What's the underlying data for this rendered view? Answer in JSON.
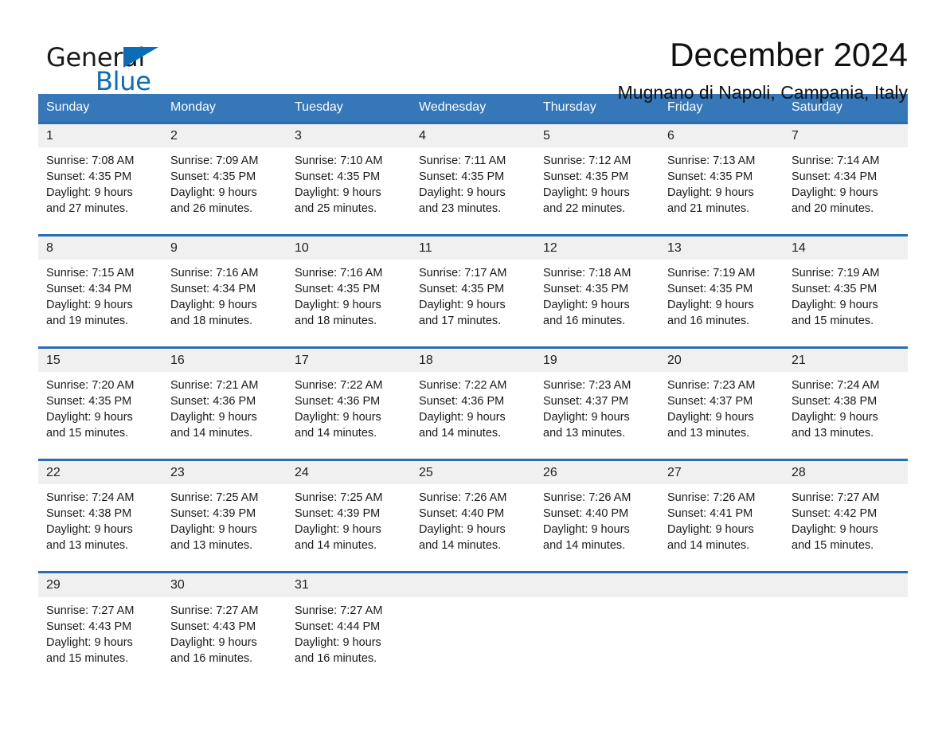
{
  "brand": {
    "name_part1": "General",
    "name_part2": "Blue",
    "accent_color": "#0b6cb7"
  },
  "header": {
    "month_title": "December 2024",
    "location": "Mugnano di Napoli, Campania, Italy"
  },
  "calendar": {
    "header_bg": "#3577b9",
    "row_divider_color": "#2b6cad",
    "daynum_bg": "#f0f0f0",
    "weekdays": [
      "Sunday",
      "Monday",
      "Tuesday",
      "Wednesday",
      "Thursday",
      "Friday",
      "Saturday"
    ],
    "weeks": [
      [
        {
          "day": "1",
          "sunrise": "Sunrise: 7:08 AM",
          "sunset": "Sunset: 4:35 PM",
          "daylight_l1": "Daylight: 9 hours",
          "daylight_l2": "and 27 minutes."
        },
        {
          "day": "2",
          "sunrise": "Sunrise: 7:09 AM",
          "sunset": "Sunset: 4:35 PM",
          "daylight_l1": "Daylight: 9 hours",
          "daylight_l2": "and 26 minutes."
        },
        {
          "day": "3",
          "sunrise": "Sunrise: 7:10 AM",
          "sunset": "Sunset: 4:35 PM",
          "daylight_l1": "Daylight: 9 hours",
          "daylight_l2": "and 25 minutes."
        },
        {
          "day": "4",
          "sunrise": "Sunrise: 7:11 AM",
          "sunset": "Sunset: 4:35 PM",
          "daylight_l1": "Daylight: 9 hours",
          "daylight_l2": "and 23 minutes."
        },
        {
          "day": "5",
          "sunrise": "Sunrise: 7:12 AM",
          "sunset": "Sunset: 4:35 PM",
          "daylight_l1": "Daylight: 9 hours",
          "daylight_l2": "and 22 minutes."
        },
        {
          "day": "6",
          "sunrise": "Sunrise: 7:13 AM",
          "sunset": "Sunset: 4:35 PM",
          "daylight_l1": "Daylight: 9 hours",
          "daylight_l2": "and 21 minutes."
        },
        {
          "day": "7",
          "sunrise": "Sunrise: 7:14 AM",
          "sunset": "Sunset: 4:34 PM",
          "daylight_l1": "Daylight: 9 hours",
          "daylight_l2": "and 20 minutes."
        }
      ],
      [
        {
          "day": "8",
          "sunrise": "Sunrise: 7:15 AM",
          "sunset": "Sunset: 4:34 PM",
          "daylight_l1": "Daylight: 9 hours",
          "daylight_l2": "and 19 minutes."
        },
        {
          "day": "9",
          "sunrise": "Sunrise: 7:16 AM",
          "sunset": "Sunset: 4:34 PM",
          "daylight_l1": "Daylight: 9 hours",
          "daylight_l2": "and 18 minutes."
        },
        {
          "day": "10",
          "sunrise": "Sunrise: 7:16 AM",
          "sunset": "Sunset: 4:35 PM",
          "daylight_l1": "Daylight: 9 hours",
          "daylight_l2": "and 18 minutes."
        },
        {
          "day": "11",
          "sunrise": "Sunrise: 7:17 AM",
          "sunset": "Sunset: 4:35 PM",
          "daylight_l1": "Daylight: 9 hours",
          "daylight_l2": "and 17 minutes."
        },
        {
          "day": "12",
          "sunrise": "Sunrise: 7:18 AM",
          "sunset": "Sunset: 4:35 PM",
          "daylight_l1": "Daylight: 9 hours",
          "daylight_l2": "and 16 minutes."
        },
        {
          "day": "13",
          "sunrise": "Sunrise: 7:19 AM",
          "sunset": "Sunset: 4:35 PM",
          "daylight_l1": "Daylight: 9 hours",
          "daylight_l2": "and 16 minutes."
        },
        {
          "day": "14",
          "sunrise": "Sunrise: 7:19 AM",
          "sunset": "Sunset: 4:35 PM",
          "daylight_l1": "Daylight: 9 hours",
          "daylight_l2": "and 15 minutes."
        }
      ],
      [
        {
          "day": "15",
          "sunrise": "Sunrise: 7:20 AM",
          "sunset": "Sunset: 4:35 PM",
          "daylight_l1": "Daylight: 9 hours",
          "daylight_l2": "and 15 minutes."
        },
        {
          "day": "16",
          "sunrise": "Sunrise: 7:21 AM",
          "sunset": "Sunset: 4:36 PM",
          "daylight_l1": "Daylight: 9 hours",
          "daylight_l2": "and 14 minutes."
        },
        {
          "day": "17",
          "sunrise": "Sunrise: 7:22 AM",
          "sunset": "Sunset: 4:36 PM",
          "daylight_l1": "Daylight: 9 hours",
          "daylight_l2": "and 14 minutes."
        },
        {
          "day": "18",
          "sunrise": "Sunrise: 7:22 AM",
          "sunset": "Sunset: 4:36 PM",
          "daylight_l1": "Daylight: 9 hours",
          "daylight_l2": "and 14 minutes."
        },
        {
          "day": "19",
          "sunrise": "Sunrise: 7:23 AM",
          "sunset": "Sunset: 4:37 PM",
          "daylight_l1": "Daylight: 9 hours",
          "daylight_l2": "and 13 minutes."
        },
        {
          "day": "20",
          "sunrise": "Sunrise: 7:23 AM",
          "sunset": "Sunset: 4:37 PM",
          "daylight_l1": "Daylight: 9 hours",
          "daylight_l2": "and 13 minutes."
        },
        {
          "day": "21",
          "sunrise": "Sunrise: 7:24 AM",
          "sunset": "Sunset: 4:38 PM",
          "daylight_l1": "Daylight: 9 hours",
          "daylight_l2": "and 13 minutes."
        }
      ],
      [
        {
          "day": "22",
          "sunrise": "Sunrise: 7:24 AM",
          "sunset": "Sunset: 4:38 PM",
          "daylight_l1": "Daylight: 9 hours",
          "daylight_l2": "and 13 minutes."
        },
        {
          "day": "23",
          "sunrise": "Sunrise: 7:25 AM",
          "sunset": "Sunset: 4:39 PM",
          "daylight_l1": "Daylight: 9 hours",
          "daylight_l2": "and 13 minutes."
        },
        {
          "day": "24",
          "sunrise": "Sunrise: 7:25 AM",
          "sunset": "Sunset: 4:39 PM",
          "daylight_l1": "Daylight: 9 hours",
          "daylight_l2": "and 14 minutes."
        },
        {
          "day": "25",
          "sunrise": "Sunrise: 7:26 AM",
          "sunset": "Sunset: 4:40 PM",
          "daylight_l1": "Daylight: 9 hours",
          "daylight_l2": "and 14 minutes."
        },
        {
          "day": "26",
          "sunrise": "Sunrise: 7:26 AM",
          "sunset": "Sunset: 4:40 PM",
          "daylight_l1": "Daylight: 9 hours",
          "daylight_l2": "and 14 minutes."
        },
        {
          "day": "27",
          "sunrise": "Sunrise: 7:26 AM",
          "sunset": "Sunset: 4:41 PM",
          "daylight_l1": "Daylight: 9 hours",
          "daylight_l2": "and 14 minutes."
        },
        {
          "day": "28",
          "sunrise": "Sunrise: 7:27 AM",
          "sunset": "Sunset: 4:42 PM",
          "daylight_l1": "Daylight: 9 hours",
          "daylight_l2": "and 15 minutes."
        }
      ],
      [
        {
          "day": "29",
          "sunrise": "Sunrise: 7:27 AM",
          "sunset": "Sunset: 4:43 PM",
          "daylight_l1": "Daylight: 9 hours",
          "daylight_l2": "and 15 minutes."
        },
        {
          "day": "30",
          "sunrise": "Sunrise: 7:27 AM",
          "sunset": "Sunset: 4:43 PM",
          "daylight_l1": "Daylight: 9 hours",
          "daylight_l2": "and 16 minutes."
        },
        {
          "day": "31",
          "sunrise": "Sunrise: 7:27 AM",
          "sunset": "Sunset: 4:44 PM",
          "daylight_l1": "Daylight: 9 hours",
          "daylight_l2": "and 16 minutes."
        },
        {
          "day": "",
          "sunrise": "",
          "sunset": "",
          "daylight_l1": "",
          "daylight_l2": ""
        },
        {
          "day": "",
          "sunrise": "",
          "sunset": "",
          "daylight_l1": "",
          "daylight_l2": ""
        },
        {
          "day": "",
          "sunrise": "",
          "sunset": "",
          "daylight_l1": "",
          "daylight_l2": ""
        },
        {
          "day": "",
          "sunrise": "",
          "sunset": "",
          "daylight_l1": "",
          "daylight_l2": ""
        }
      ]
    ]
  }
}
